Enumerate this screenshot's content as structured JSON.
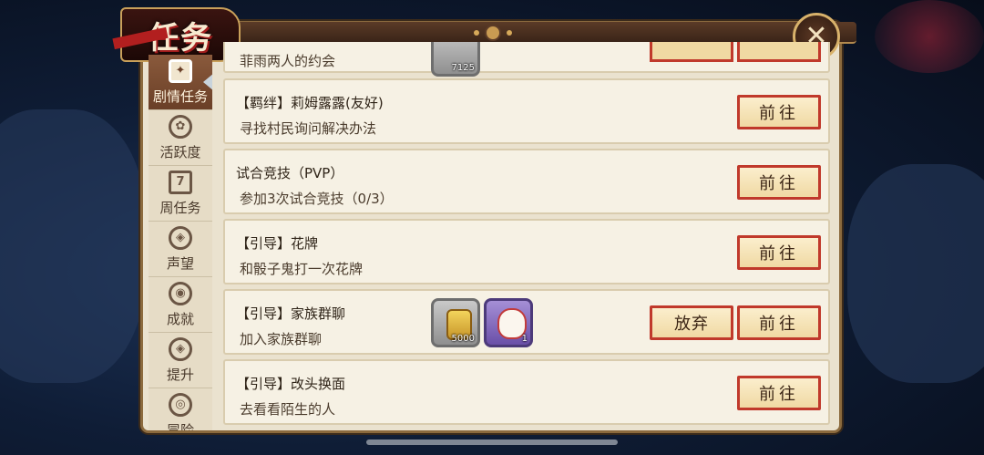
{
  "header": {
    "title": "任务"
  },
  "sidebar": {
    "items": [
      {
        "label": "剧情任务",
        "icon": "story-icon",
        "active": true
      },
      {
        "label": "活跃度",
        "icon": "activity-icon"
      },
      {
        "label": "周任务",
        "icon": "calendar-icon",
        "badge": "7"
      },
      {
        "label": "声望",
        "icon": "reputation-icon"
      },
      {
        "label": "成就",
        "icon": "achievement-icon"
      },
      {
        "label": "提升",
        "icon": "upgrade-icon"
      },
      {
        "label": "冒险",
        "icon": "adventure-icon"
      }
    ]
  },
  "tasks": [
    {
      "partial_title": "菲雨两人的约会",
      "reward_count": "7125"
    },
    {
      "title": "【羁绊】莉姆露露(友好)",
      "desc": "寻找村民询问解决办法",
      "go_label": "前往"
    },
    {
      "title": "试合竞技（PVP）",
      "desc": "参加3次试合竞技（0/3）",
      "go_label": "前往"
    },
    {
      "title": "【引导】花牌",
      "desc": "和骰子鬼打一次花牌",
      "go_label": "前往"
    },
    {
      "title": "【引导】家族群聊",
      "desc": "加入家族群聊",
      "go_label": "前往",
      "abandon_label": "放弃",
      "rewards": [
        {
          "icon": "gold-coin-icon",
          "count": "5000"
        },
        {
          "icon": "lucky-cat-icon",
          "count": "1"
        }
      ]
    },
    {
      "title": "【引导】改头换面",
      "desc": "去看看陌生的人",
      "go_label": "前往"
    }
  ],
  "colors": {
    "accent_red": "#c0392b",
    "panel": "#eae2cf",
    "button_fill": "#f0d9a3"
  }
}
